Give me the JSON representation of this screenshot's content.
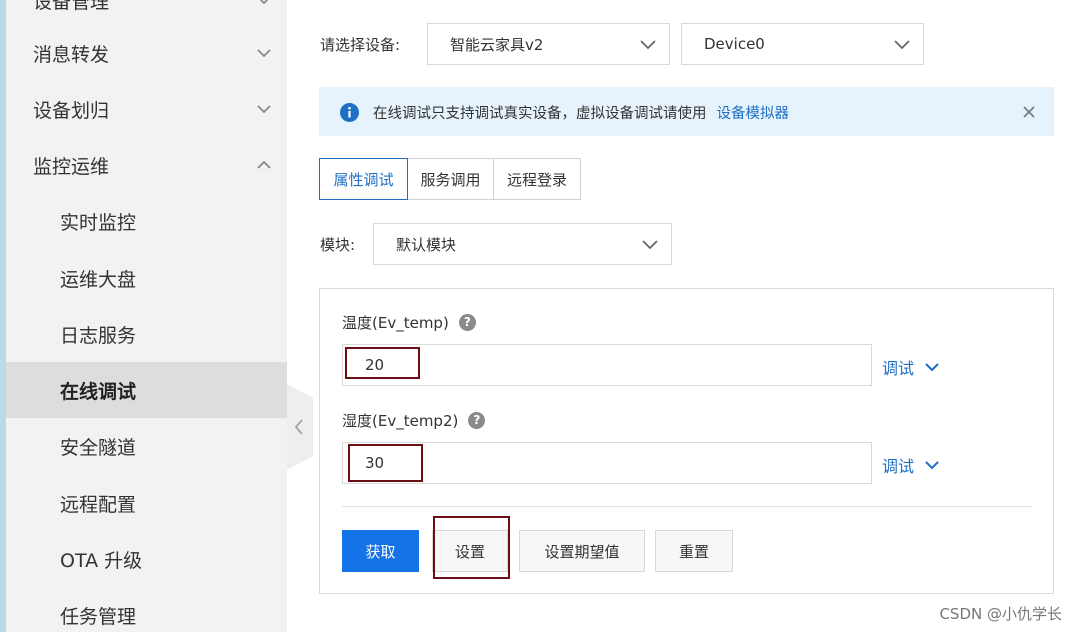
{
  "sidebar": {
    "items": [
      {
        "label": "设备管理",
        "chevron": "down"
      },
      {
        "label": "消息转发",
        "chevron": "down"
      },
      {
        "label": "设备划归",
        "chevron": "down"
      },
      {
        "label": "监控运维",
        "chevron": "up"
      },
      {
        "label": "实时监控"
      },
      {
        "label": "运维大盘"
      },
      {
        "label": "日志服务"
      },
      {
        "label": "在线调试",
        "active": true
      },
      {
        "label": "安全隧道"
      },
      {
        "label": "远程配置"
      },
      {
        "label": "OTA 升级"
      },
      {
        "label": "任务管理"
      }
    ]
  },
  "device_select": {
    "label": "请选择设备:",
    "product": "智能云家具v2",
    "device": "Device0"
  },
  "alert": {
    "message": "在线调试只支持调试真实设备，虚拟设备调试请使用",
    "link": "设备模拟器"
  },
  "tabs": [
    {
      "label": "属性调试",
      "active": true
    },
    {
      "label": "服务调用"
    },
    {
      "label": "远程登录"
    }
  ],
  "module": {
    "label": "模块:",
    "value": "默认模块"
  },
  "fields": [
    {
      "label": "温度(Ev_temp)",
      "value": "20",
      "action": "调试"
    },
    {
      "label": "湿度(Ev_temp2)",
      "value": "30",
      "action": "调试"
    }
  ],
  "buttons": {
    "get": "获取",
    "set": "设置",
    "set_expected": "设置期望值",
    "reset": "重置"
  },
  "help_glyph": "?",
  "watermark": "CSDN @小仇学长",
  "colors": {
    "accent": "#1f6fc5",
    "primary_button": "#1473e6",
    "alert_bg": "#e6f3fc",
    "highlight_box": "#6b0f14"
  }
}
